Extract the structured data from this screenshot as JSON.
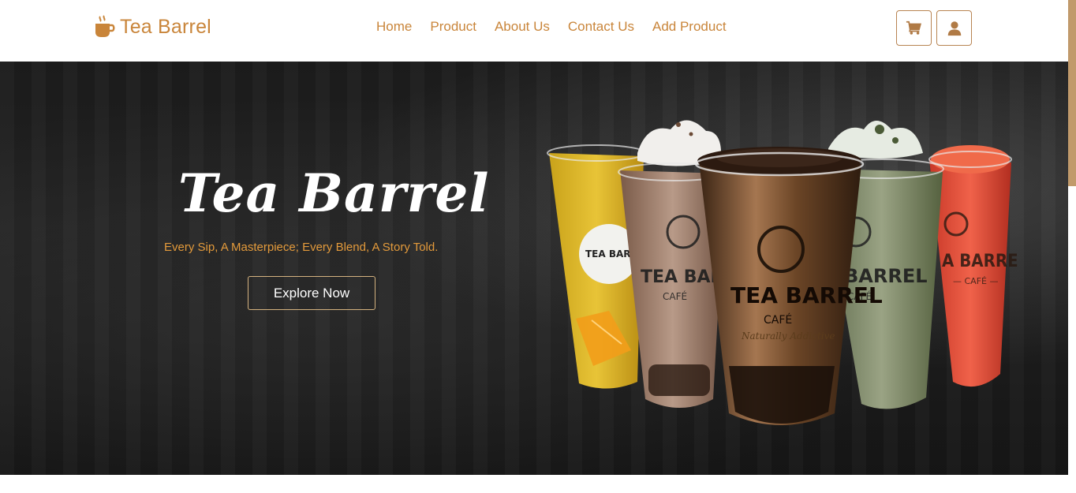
{
  "brand": {
    "name": "Tea Barrel",
    "icon": "coffee-cup-icon",
    "color": "#c9853a"
  },
  "nav": {
    "links": [
      {
        "label": "Home"
      },
      {
        "label": "Product"
      },
      {
        "label": "About Us"
      },
      {
        "label": "Contact Us"
      },
      {
        "label": "Add Product"
      }
    ],
    "icons": [
      {
        "name": "cart-icon"
      },
      {
        "name": "user-icon"
      }
    ]
  },
  "hero": {
    "title": "Tea Barrel",
    "tagline": "Every Sip, A Masterpiece; Every Blend, A Story Told.",
    "cta_label": "Explore Now",
    "cup_label_main": "TEA BARREL",
    "cup_label_sub": "CAFÉ",
    "cup_label_slogan": "Naturally Addictive",
    "tagline_color": "#e39a3b",
    "background_color": "#1e1e1e"
  }
}
